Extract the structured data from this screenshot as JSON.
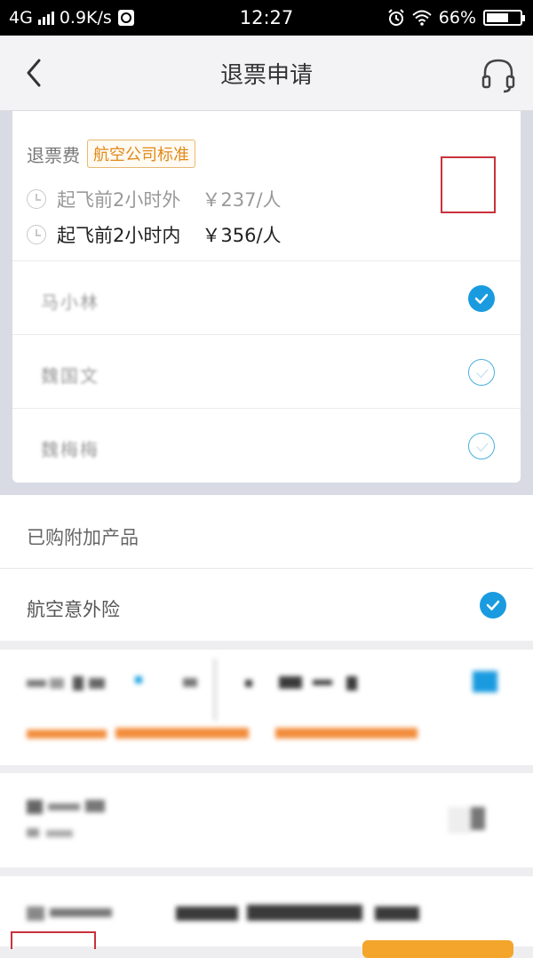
{
  "status_bar": {
    "network": "4G",
    "speed": "0.9K/s",
    "time": "12:27",
    "battery_percent": "66%",
    "battery_level": 0.66
  },
  "header": {
    "title": "退票申请",
    "back_icon": "chevron-left-icon",
    "support_icon": "headset-icon"
  },
  "refund": {
    "fee_label": "退票费",
    "fee_tag": "航空公司标准",
    "rules": [
      {
        "text": "起飞前2小时外",
        "amount": "￥237/人",
        "active": false
      },
      {
        "text": "起飞前2小时内",
        "amount": "￥356/人",
        "active": true
      }
    ]
  },
  "passengers": [
    {
      "name": "马小林",
      "checked": true
    },
    {
      "name": "魏国文",
      "checked": false
    },
    {
      "name": "魏梅梅",
      "checked": false
    }
  ],
  "addons": {
    "title": "已购附加产品",
    "items": [
      {
        "label": "航空意外险",
        "checked": true
      }
    ]
  },
  "colors": {
    "accent_blue": "#1a9be0",
    "tag_orange": "#e08a1a",
    "highlight_red": "#c8323a"
  }
}
